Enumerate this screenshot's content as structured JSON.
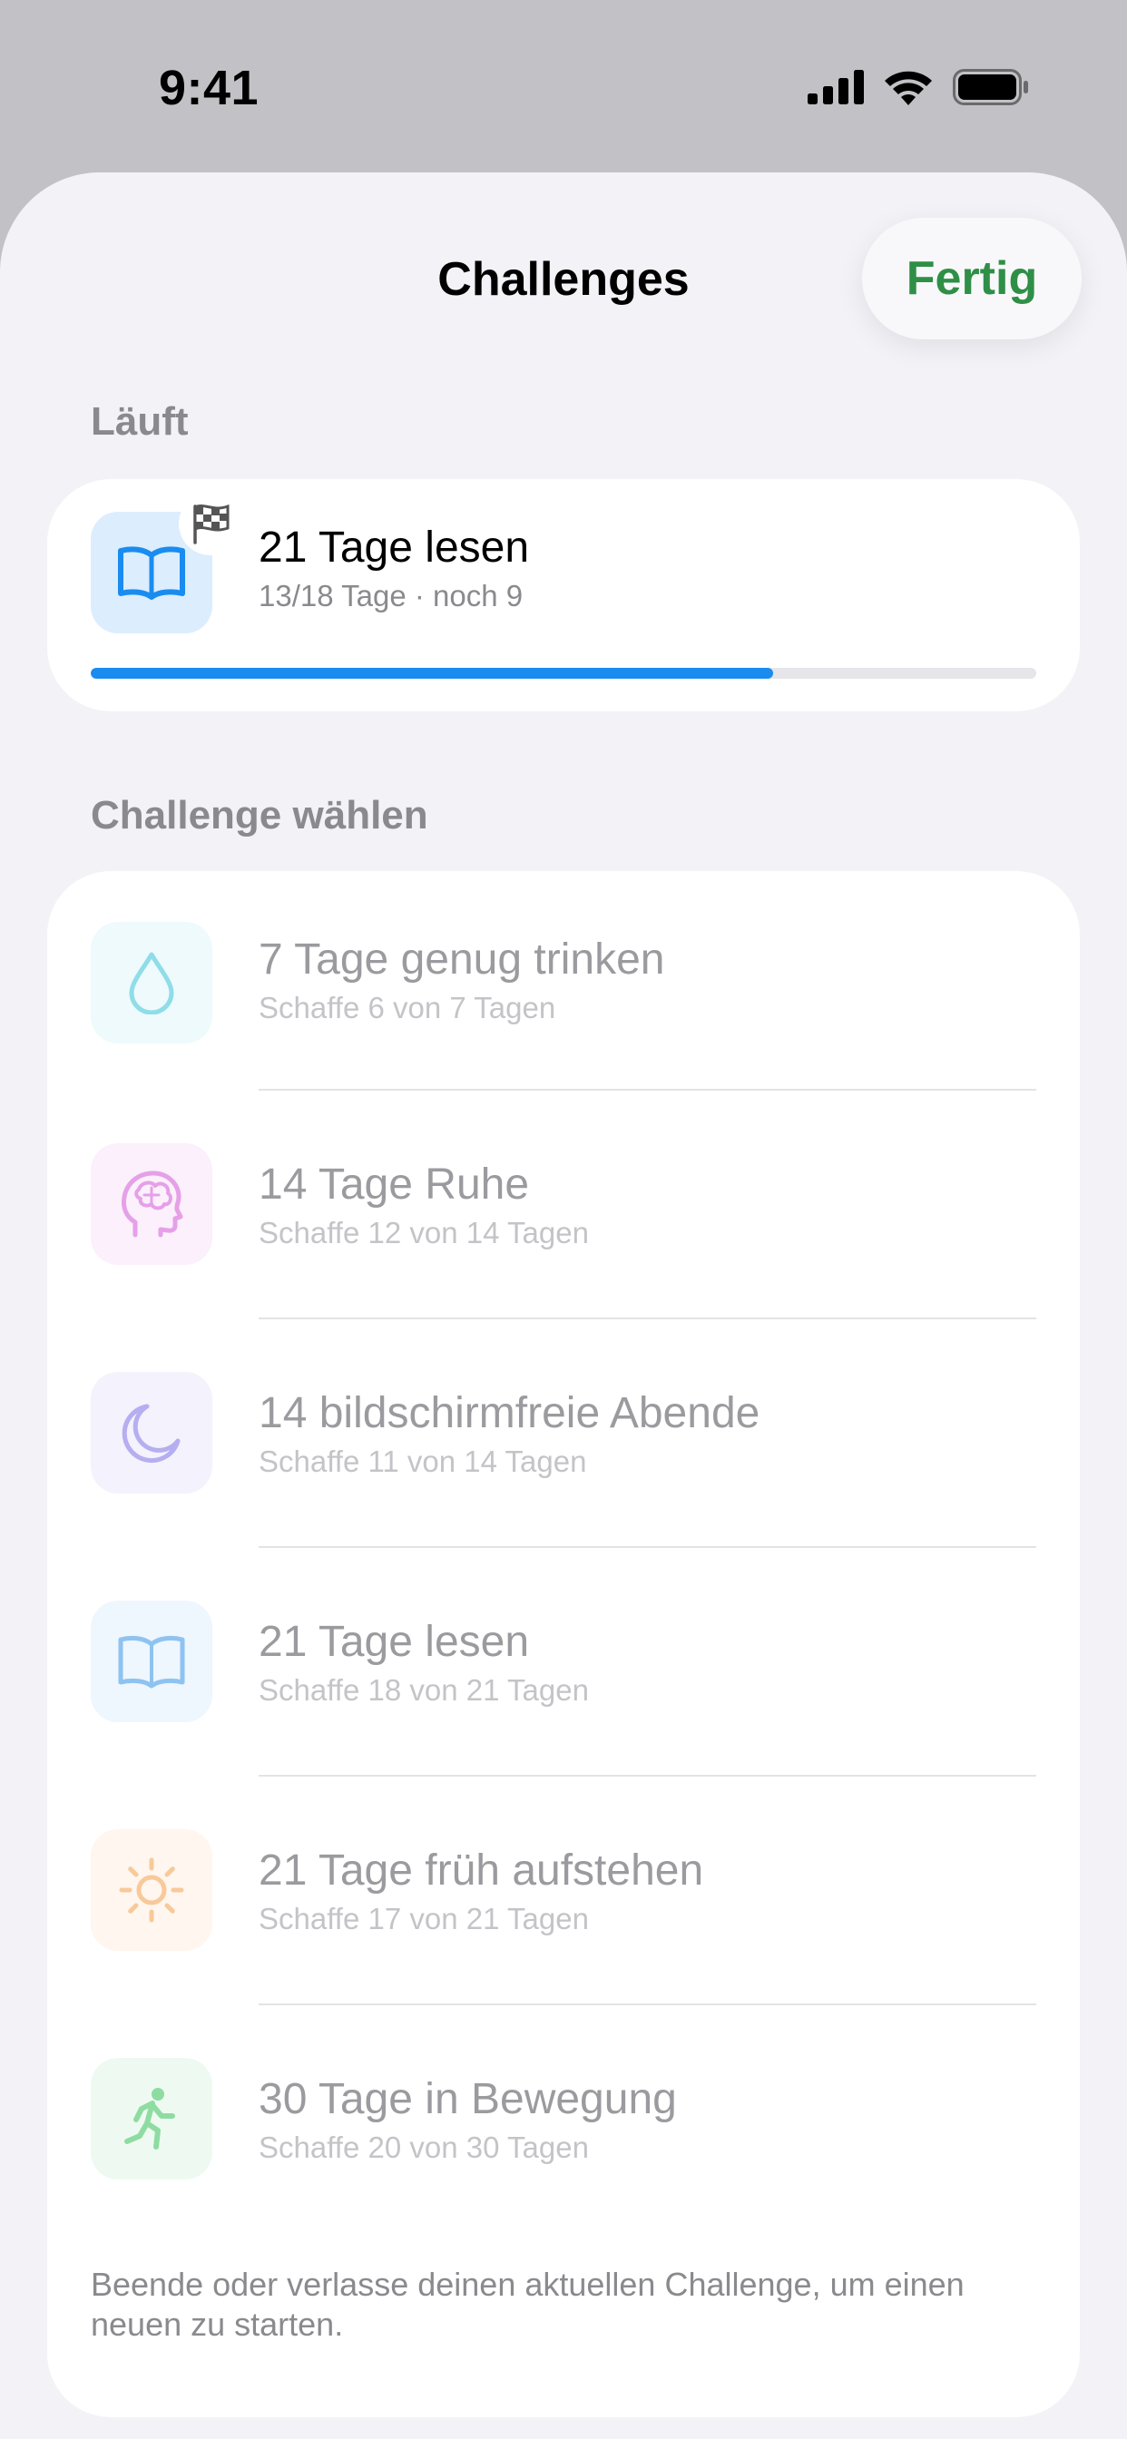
{
  "status_bar": {
    "time": "9:41"
  },
  "nav": {
    "title": "Challenges",
    "done_label": "Fertig"
  },
  "running": {
    "header": "Läuft",
    "title": "21 Tage lesen",
    "subtitle": "13/18 Tage · noch 9",
    "progress": 0.722,
    "icon": "book-icon",
    "badge_icon": "checkered-flag-icon"
  },
  "choose": {
    "header": "Challenge wählen",
    "items": [
      {
        "title": "7 Tage genug trinken",
        "subtitle": "Schaffe 6 von 7 Tagen",
        "icon": "water-drop-icon",
        "tile_color": "#eefafc",
        "icon_color": "#8fdde8"
      },
      {
        "title": "14 Tage Ruhe",
        "subtitle": "Schaffe 12 von 14 Tagen",
        "icon": "brain-head-icon",
        "tile_color": "#fbf0fb",
        "icon_color": "#e5a0e8"
      },
      {
        "title": "14 bildschirmfreie Abende",
        "subtitle": "Schaffe 11 von 14 Tagen",
        "icon": "moon-icon",
        "tile_color": "#f3f2fd",
        "icon_color": "#b5aef0"
      },
      {
        "title": "21 Tage lesen",
        "subtitle": "Schaffe 18 von 21 Tagen",
        "icon": "book-icon",
        "tile_color": "#eef6fe",
        "icon_color": "#8ec3f1"
      },
      {
        "title": "21 Tage früh aufstehen",
        "subtitle": "Schaffe 17 von 21 Tagen",
        "icon": "sun-icon",
        "tile_color": "#fef6ef",
        "icon_color": "#f8c99a"
      },
      {
        "title": "30 Tage in Bewegung",
        "subtitle": "Schaffe 20 von 30 Tagen",
        "icon": "running-person-icon",
        "tile_color": "#eefaf1",
        "icon_color": "#8fdca3"
      }
    ]
  },
  "footer": "Beende oder verlasse deinen aktuellen Challenge, um einen neuen zu starten.",
  "colors": {
    "accent_green": "#2f8f46",
    "progress_blue": "#1a8cf0",
    "sheet_bg": "#f2f2f7"
  }
}
